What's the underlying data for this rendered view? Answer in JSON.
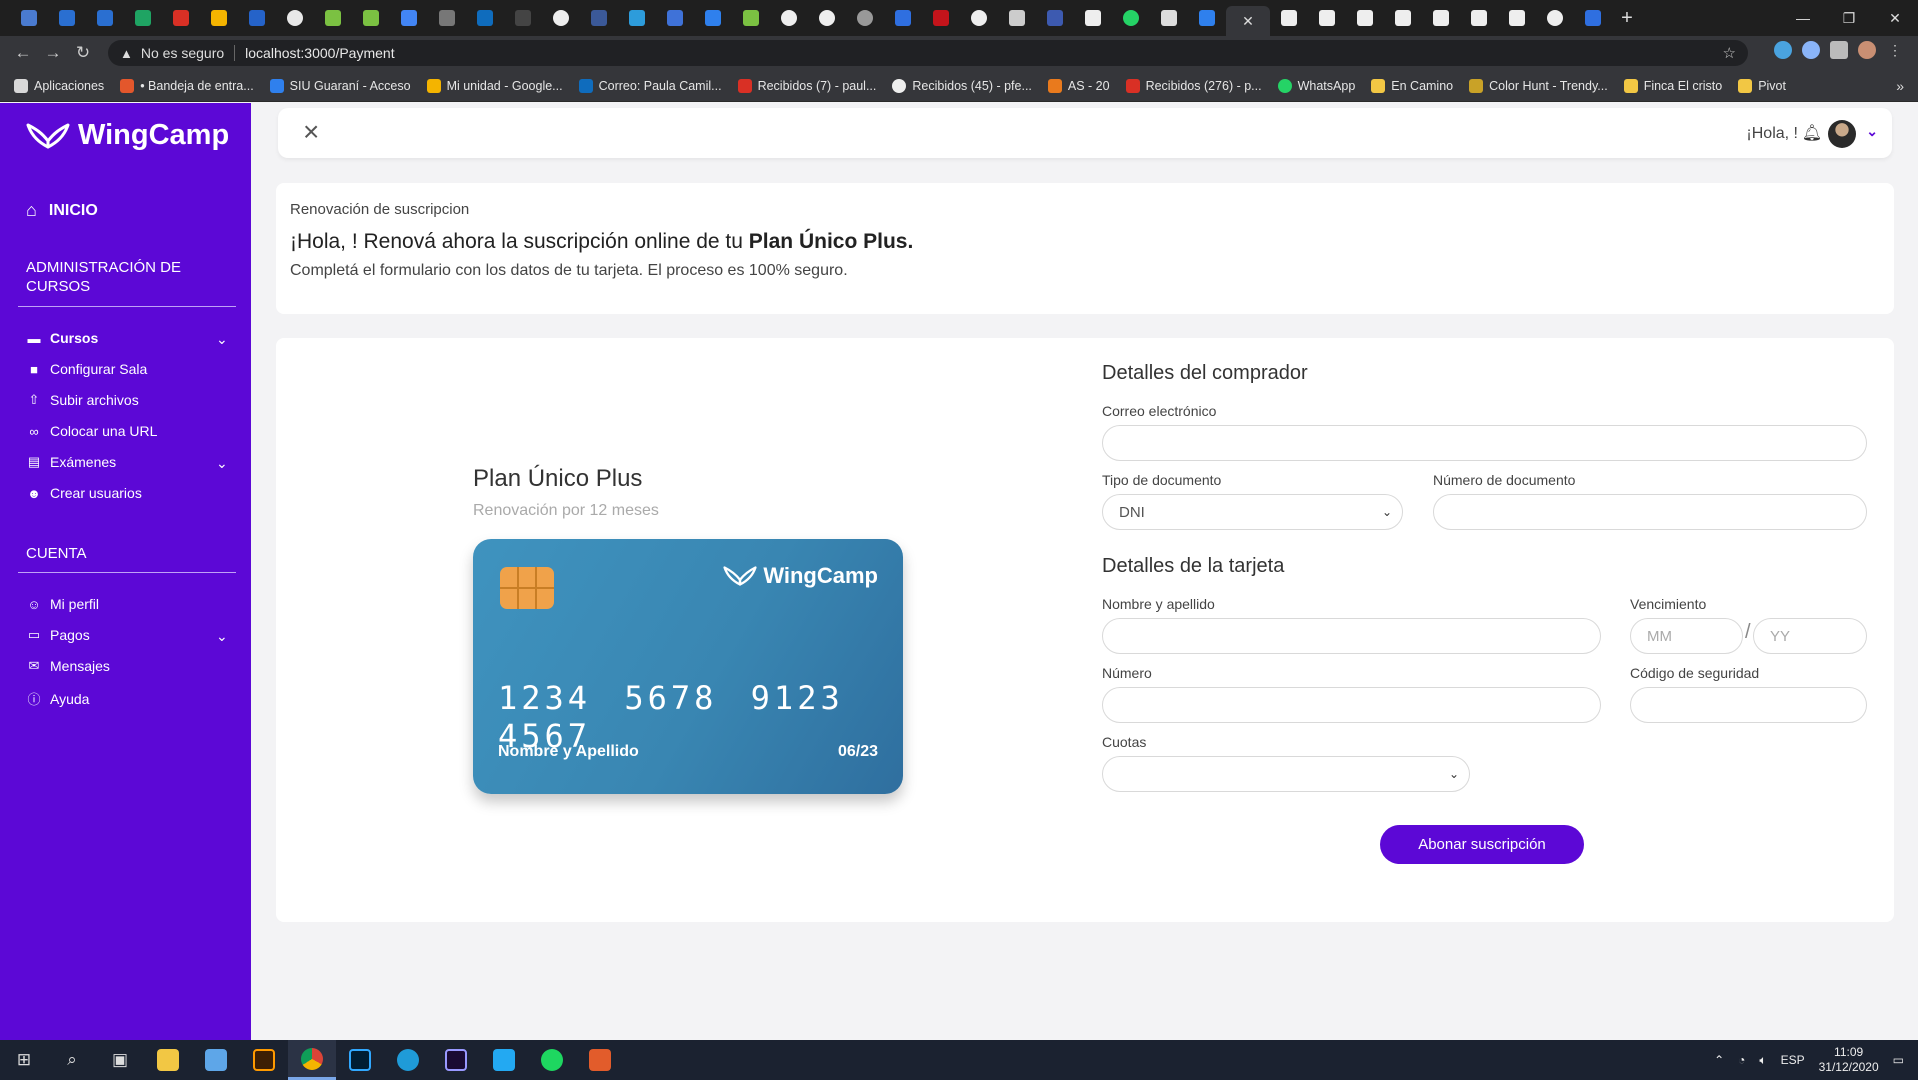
{
  "browser": {
    "tab_close": "✕",
    "new_tab": "+",
    "warning_label": "No es seguro",
    "url": "localhost:3000/Payment",
    "bookmarks": [
      "Aplicaciones",
      "• Bandeja de entra...",
      "SIU Guaraní - Acceso",
      "Mi unidad - Google...",
      "Correo: Paula Camil...",
      "Recibidos (7) - paul...",
      "Recibidos (45) - pfe...",
      "AS - 20",
      "Recibidos (276) - p...",
      "WhatsApp",
      "En Camino",
      "Color Hunt - Trendy...",
      "Finca El cristo",
      "Pivot"
    ]
  },
  "sidebar": {
    "brand": "WingCamp",
    "home": "INICIO",
    "section_admin": "ADMINISTRACIÓN DE CURSOS",
    "admin_items": [
      "Cursos",
      "Configurar Sala",
      "Subir archivos",
      "Colocar una URL",
      "Exámenes",
      "Crear usuarios"
    ],
    "section_account": "CUENTA",
    "account_items": [
      "Mi perfil",
      "Pagos",
      "Mensajes",
      "Ayuda"
    ]
  },
  "topbar": {
    "greeting": "¡Hola, !"
  },
  "header": {
    "subtitle": "Renovación de suscripcion",
    "title_prefix": "¡Hola, ! Renová ahora la suscripción online de tu ",
    "title_plan": "Plan Único Plus.",
    "description": "Completá el formulario con los datos de tu tarjeta. El proceso es 100% seguro."
  },
  "plan": {
    "name": "Plan Único Plus",
    "subtitle": "Renovación por 12 meses"
  },
  "card": {
    "brand": "WingCamp",
    "number": "1234 5678 9123 4567",
    "holder": "Nombre y Apellido",
    "expiry": "06/23"
  },
  "buyer": {
    "title": "Detalles del comprador",
    "email_label": "Correo electrónico",
    "email_value": "",
    "doc_type_label": "Tipo de documento",
    "doc_type_value": "DNI",
    "doc_number_label": "Número de documento",
    "doc_number_value": ""
  },
  "payment": {
    "title": "Detalles de la tarjeta",
    "name_label": "Nombre y apellido",
    "expiry_label": "Vencimiento",
    "month_placeholder": "MM",
    "year_placeholder": "YY",
    "number_label": "Número",
    "cvv_label": "Código de seguridad",
    "installments_label": "Cuotas",
    "installments_value": "",
    "submit": "Abonar suscripción"
  },
  "taskbar": {
    "language": "ESP",
    "time": "11:09",
    "date": "31/12/2020"
  },
  "colors": {
    "brand_purple": "#5c08d6",
    "card_blue": "#3986b2",
    "chip_orange": "#f0a24a"
  }
}
